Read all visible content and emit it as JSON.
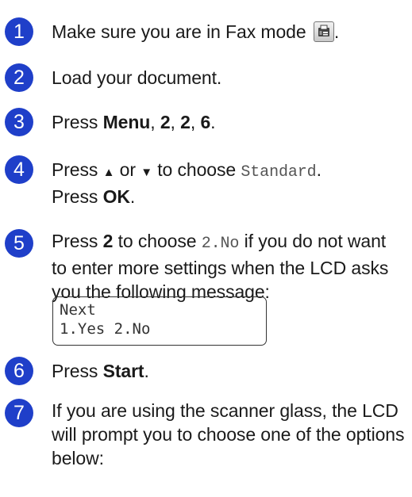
{
  "steps": [
    {
      "number": "1",
      "text": "Make sure you are in Fax mode",
      "end": "."
    },
    {
      "number": "2",
      "text": "Load your document."
    },
    {
      "number": "3",
      "pre": "Press ",
      "menu": "Menu",
      "sep1": ", ",
      "k1": "2",
      "sep2": ", ",
      "k2": "2",
      "sep3": ", ",
      "k3": "6",
      "end": "."
    },
    {
      "number": "4",
      "pre": "Press ",
      "up": "▲",
      "or": " or ",
      "down": "▼",
      "mid": " to choose ",
      "code": "Standard",
      "end": ".",
      "line2_pre": "Press ",
      "ok": "OK",
      "line2_end": "."
    },
    {
      "number": "5",
      "pre": "Press ",
      "key": "2",
      "mid": " to choose ",
      "code": "2.No",
      "rest": " if you do not want to enter more settings when the LCD asks you the following message:"
    },
    {
      "number": "6",
      "pre": "Press ",
      "start": "Start",
      "end": "."
    },
    {
      "number": "7",
      "text": "If you are using the scanner glass, the LCD will prompt you to choose one of the options below:"
    }
  ],
  "lcd": {
    "line1": "Next",
    "line2": "1.Yes 2.No"
  },
  "icons": {
    "fax_mode": "fax-icon"
  }
}
